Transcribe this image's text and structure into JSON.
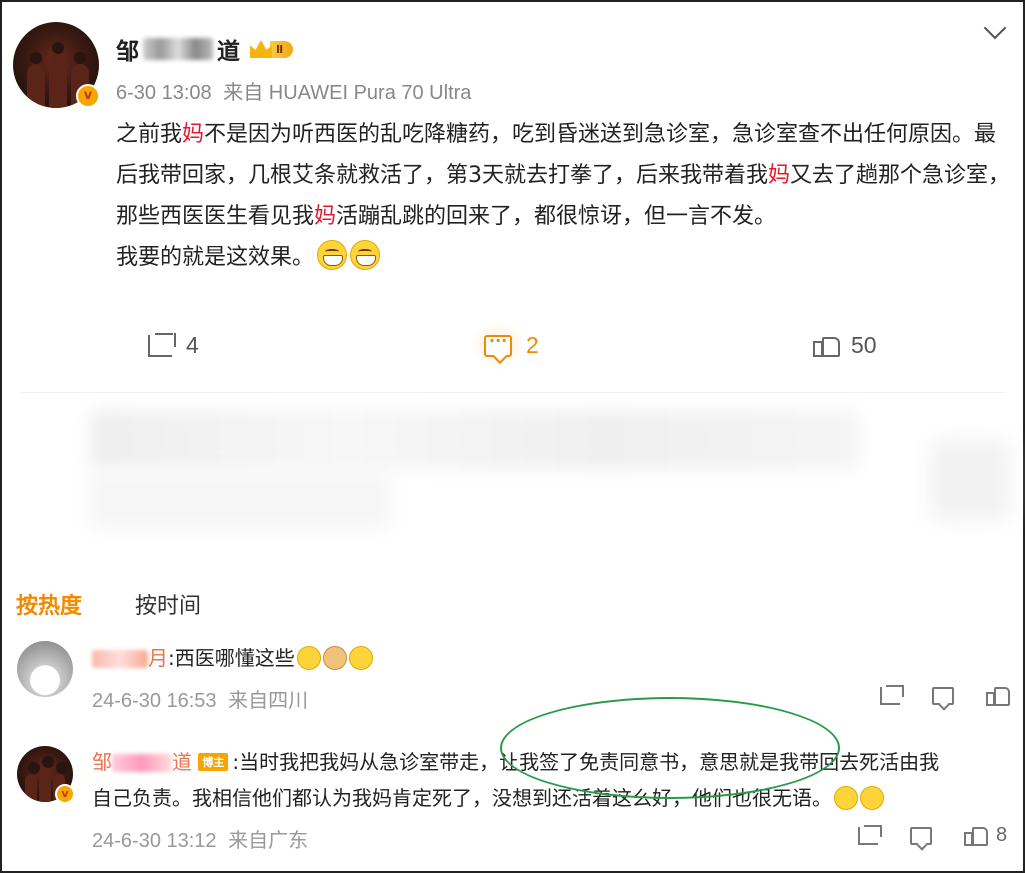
{
  "post": {
    "username_visible_start": "邹",
    "username_visible_end": "道",
    "level_badge": "Ⅱ",
    "verified_badge": "v",
    "timestamp": "6-30 13:08",
    "source": "来自 HUAWEI Pura 70 Ultra",
    "text_parts": {
      "p1": "之前我",
      "m1": "妈",
      "p2": "不是因为听西医的乱吃降糖药，吃到昏迷送到急诊室，急诊室查不出任何原因。最后我带回家，几根艾条就救活了，第3天就去打拳了，后来我带着我",
      "m2": "妈",
      "p3": "又去了趟那个急诊室，那些西医医生看见我",
      "m3": "妈",
      "p4": "活蹦乱跳的回来了，都很惊讶，但一言不发。",
      "p5": "我要的就是这效果。"
    },
    "emojis": [
      "grin-emoji",
      "grin-emoji"
    ],
    "actions": {
      "share_count": "4",
      "comment_count": "2",
      "like_count": "50"
    }
  },
  "sort": {
    "hot": "按热度",
    "time": "按时间"
  },
  "comments": [
    {
      "name_suffix": "月",
      "text": ":西医哪懂这些",
      "emojis": [
        "laugh-cry-emoji",
        "doge-emoji",
        "laugh-emoji"
      ],
      "timestamp": "24-6-30 16:53",
      "source": "来自四川"
    },
    {
      "name_start": "邹",
      "name_end": "道",
      "badge": "博主",
      "text_line1": ":当时我把我妈从急诊室带走，让我签了免责同意书，意思就是我带回去死活由我",
      "text_line2": "自己负责。我相信他们都认为我妈肯定死了，没想到还活着这么好，他们也很无语。",
      "emojis": [
        "laugh-emoji",
        "laugh-emoji"
      ],
      "timestamp": "24-6-30 13:12",
      "source": "来自广东",
      "like_count": "8"
    }
  ],
  "colors": {
    "accent": "#f08a00",
    "highlight_red": "#e6162d",
    "annotation_green": "#2a9a4a"
  }
}
